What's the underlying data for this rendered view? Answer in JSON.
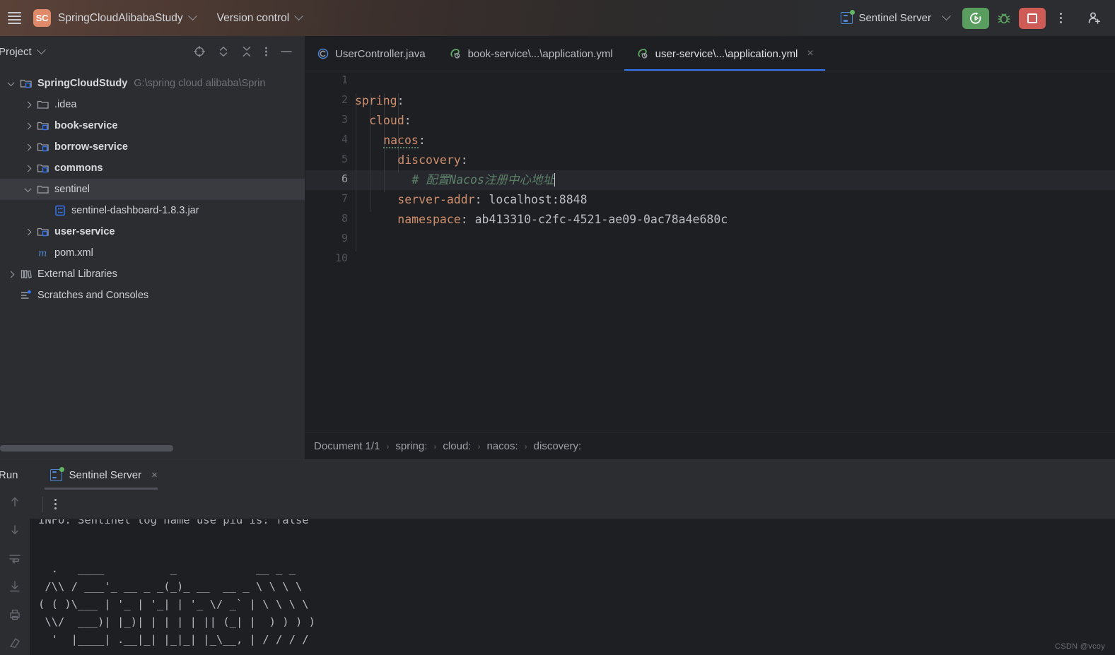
{
  "titlebar": {
    "menu_icon": "hamburger-icon",
    "project_badge": "SC",
    "project_name": "SpringCloudAlibabaStudy",
    "vcs_label": "Version control",
    "run_config": "Sentinel Server",
    "run_icon": "run-with-coverage-icon",
    "debug_icon": "debug-bug-icon",
    "stop_icon": "stop-square-icon",
    "more_icon": "more-vertical-icon",
    "account_icon": "add-account-icon"
  },
  "project_panel": {
    "title": "Project",
    "toolbar": [
      {
        "name": "select-opened-file-icon"
      },
      {
        "name": "expand-collapse-icon"
      },
      {
        "name": "collapse-all-icon"
      },
      {
        "name": "options-more-icon"
      },
      {
        "name": "hide-panel-icon"
      }
    ],
    "tree": [
      {
        "label": "SpringCloudStudy",
        "path": "G:\\spring cloud alibaba\\Sprin",
        "indent": 0,
        "arrow": "down",
        "icon": "module-folder-icon",
        "bold": true,
        "selected": false
      },
      {
        "label": ".idea",
        "path": "",
        "indent": 1,
        "arrow": "right",
        "icon": "folder-icon",
        "bold": false,
        "selected": false
      },
      {
        "label": "book-service",
        "path": "",
        "indent": 1,
        "arrow": "right",
        "icon": "module-folder-icon",
        "bold": true,
        "selected": false
      },
      {
        "label": "borrow-service",
        "path": "",
        "indent": 1,
        "arrow": "right",
        "icon": "module-folder-icon",
        "bold": true,
        "selected": false
      },
      {
        "label": "commons",
        "path": "",
        "indent": 1,
        "arrow": "right",
        "icon": "module-folder-icon",
        "bold": true,
        "selected": false
      },
      {
        "label": "sentinel",
        "path": "",
        "indent": 1,
        "arrow": "down",
        "icon": "folder-icon",
        "bold": false,
        "selected": true
      },
      {
        "label": "sentinel-dashboard-1.8.3.jar",
        "path": "",
        "indent": 2,
        "arrow": "none",
        "icon": "jar-file-icon",
        "bold": false,
        "selected": false
      },
      {
        "label": "user-service",
        "path": "",
        "indent": 1,
        "arrow": "right",
        "icon": "module-folder-icon",
        "bold": true,
        "selected": false
      },
      {
        "label": "pom.xml",
        "path": "",
        "indent": 1,
        "arrow": "none",
        "icon": "maven-pom-icon",
        "bold": false,
        "selected": false
      },
      {
        "label": "External Libraries",
        "path": "",
        "indent": 0,
        "arrow": "right",
        "icon": "libraries-icon",
        "bold": false,
        "selected": false
      },
      {
        "label": "Scratches and Consoles",
        "path": "",
        "indent": 0,
        "arrow": "none",
        "icon": "scratches-icon",
        "bold": false,
        "selected": false
      }
    ]
  },
  "editor": {
    "tabs": [
      {
        "label": "UserController.java",
        "icon": "java-class-icon",
        "active": false,
        "closable": false
      },
      {
        "label": "book-service\\...\\application.yml",
        "icon": "spring-yaml-icon",
        "active": false,
        "closable": false
      },
      {
        "label": "user-service\\...\\application.yml",
        "icon": "spring-yaml-icon",
        "active": true,
        "closable": true
      }
    ],
    "close_glyph": "×",
    "line_numbers": [
      "1",
      "2",
      "3",
      "4",
      "5",
      "6",
      "7",
      "8",
      "9",
      "10"
    ],
    "current_line": 6,
    "code_lines": [
      {
        "n": 1,
        "segments": []
      },
      {
        "n": 2,
        "segments": [
          {
            "t": "spring",
            "c": "k"
          },
          {
            "t": ":",
            "c": "p"
          }
        ],
        "indent": 0
      },
      {
        "n": 3,
        "segments": [
          {
            "t": "cloud",
            "c": "k"
          },
          {
            "t": ":",
            "c": "p"
          }
        ],
        "indent": 1
      },
      {
        "n": 4,
        "segments": [
          {
            "t": "nacos",
            "c": "k-underline"
          },
          {
            "t": ":",
            "c": "p"
          }
        ],
        "indent": 2
      },
      {
        "n": 5,
        "segments": [
          {
            "t": "discovery",
            "c": "k"
          },
          {
            "t": ":",
            "c": "p"
          }
        ],
        "indent": 3
      },
      {
        "n": 6,
        "segments": [
          {
            "t": "# 配置Nacos注册中心地址",
            "c": "cm"
          }
        ],
        "indent": 4
      },
      {
        "n": 7,
        "segments": [
          {
            "t": "server-addr",
            "c": "k"
          },
          {
            "t": ": ",
            "c": "p"
          },
          {
            "t": "localhost:8848",
            "c": "v"
          }
        ],
        "indent": 3
      },
      {
        "n": 8,
        "segments": [
          {
            "t": "namespace",
            "c": "k"
          },
          {
            "t": ": ",
            "c": "p"
          },
          {
            "t": "ab413310-c2fc-4521-ae09-0ac78a4e680c",
            "c": "v"
          }
        ],
        "indent": 3
      },
      {
        "n": 9,
        "segments": []
      },
      {
        "n": 10,
        "segments": []
      }
    ],
    "breadcrumb": [
      "Document 1/1",
      "spring:",
      "cloud:",
      "nacos:",
      "discovery:"
    ],
    "breadcrumb_sep": "›"
  },
  "run_panel": {
    "title": "Run",
    "tab_label": "Sentinel Server",
    "tab_icon": "spring-boot-run-icon",
    "tab_close": "×",
    "toolbar": {
      "rerun_icon": "rerun-icon",
      "stop_icon": "stop-icon",
      "more_icon": "more-vertical-icon"
    },
    "side_icons": [
      {
        "name": "scroll-up-icon"
      },
      {
        "name": "scroll-down-icon"
      },
      {
        "name": "soft-wrap-icon"
      },
      {
        "name": "scroll-to-end-icon"
      },
      {
        "name": "print-icon"
      },
      {
        "name": "clear-all-icon"
      }
    ],
    "console_cut_line": "INFO: Sentinel log name use pid is: false",
    "console_banner": [
      "  .   ____          _            __ _ _",
      " /\\\\ / ___'_ __ _ _(_)_ __  __ _ \\ \\ \\ \\",
      "( ( )\\___ | '_ | '_| | '_ \\/ _` | \\ \\ \\ \\",
      " \\\\/  ___)| |_)| | | | | || (_| |  ) ) ) )",
      "  '  |____| .__|_| |_|_| |_\\__, | / / / /"
    ]
  },
  "watermark": "CSDN @vcoy",
  "colors": {
    "accent_blue": "#3574f0",
    "run_green": "#599e5e",
    "stop_red": "#cf5b56",
    "badge_orange": "#e08a6a",
    "key_orange": "#cf8e6d",
    "comment_green": "#5f826b",
    "panel_bg": "#2b2d30",
    "editor_bg": "#1e1f22"
  }
}
